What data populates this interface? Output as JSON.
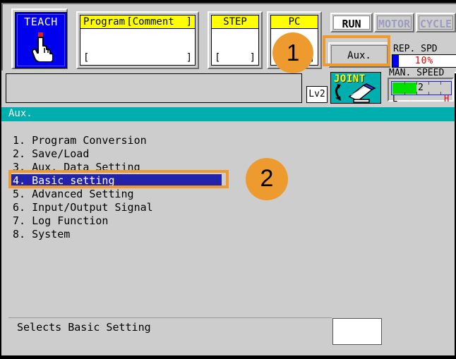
{
  "header": {
    "teach": {
      "label": "TEACH",
      "icon": "pointing-hand-icon"
    },
    "program_field": {
      "caption_left": "Program",
      "caption_right": "[Comment  ]",
      "value_left": "[",
      "value_right": "]"
    },
    "step_field": {
      "caption": "STEP",
      "value_left": "[",
      "value_right": "]"
    },
    "pc_field": {
      "caption": "PC",
      "value_left": "[",
      "value_right": "]"
    },
    "mode_buttons": [
      {
        "label": "RUN",
        "state": "active"
      },
      {
        "label": "MOTOR",
        "state": "disabled"
      },
      {
        "label": "CYCLE",
        "state": "disabled"
      }
    ],
    "aux_button": {
      "label": "Aux."
    },
    "rep_speed": {
      "label": "REP. SPD",
      "value": "10%",
      "fill_percent": 10
    },
    "man_speed": {
      "label": "MAN. SPEED",
      "value": "2",
      "low": "L",
      "high": "H",
      "fill_percent": 40
    }
  },
  "status_row": {
    "message": "",
    "level": "Lv2",
    "mode_indicator": {
      "label": "JOINT",
      "icon": "robot-arm-icon"
    }
  },
  "main": {
    "title": "Aux.",
    "menu_items": [
      {
        "number": "1.",
        "label": "Program Conversion",
        "selected": false
      },
      {
        "number": "2.",
        "label": "Save/Load",
        "selected": false
      },
      {
        "number": "3.",
        "label": "Aux. Data Setting",
        "selected": false
      },
      {
        "number": "4.",
        "label": "Basic setting",
        "selected": true
      },
      {
        "number": "5.",
        "label": "Advanced Setting",
        "selected": false
      },
      {
        "number": "6.",
        "label": "Input/Output Signal",
        "selected": false
      },
      {
        "number": "7.",
        "label": "Log Function",
        "selected": false
      },
      {
        "number": "8.",
        "label": "System",
        "selected": false
      }
    ],
    "menu_lines": [
      "1. Program Conversion",
      "2. Save/Load",
      "3. Aux. Data Setting",
      "4. Basic setting",
      "5. Advanced Setting",
      "6. Input/Output Signal",
      "7. Log Function",
      "8. System"
    ]
  },
  "bottom": {
    "hint": "Selects Basic Setting",
    "entry_value": ""
  },
  "annotations": {
    "badges": [
      {
        "number": "1",
        "target": "aux-button"
      },
      {
        "number": "2",
        "target": "menu-item-basic-setting"
      }
    ],
    "highlight_color": "#ED9A2E"
  },
  "colors": {
    "accent_teal": "#00AEAE",
    "selection_blue": "#2222AA",
    "teach_blue": "#0000EE",
    "caption_yellow": "#FFFF00",
    "annotation_orange": "#ED9A2E",
    "panel_gray": "#CDCDCD",
    "speed_red": "#E00000",
    "speed_green": "#00E000"
  }
}
